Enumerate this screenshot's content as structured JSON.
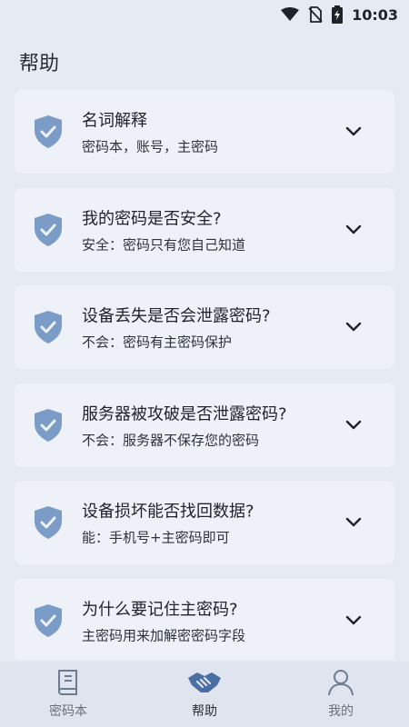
{
  "status_bar": {
    "time": "10:03"
  },
  "header": {
    "title": "帮助"
  },
  "faq": [
    {
      "question": "名词解释",
      "answer": "密码本，账号，主密码"
    },
    {
      "question": "我的密码是否安全?",
      "answer": "安全：密码只有您自己知道"
    },
    {
      "question": "设备丢失是否会泄露密码?",
      "answer": "不会：密码有主密码保护"
    },
    {
      "question": "服务器被攻破是否泄露密码?",
      "answer": "不会：服务器不保存您的密码"
    },
    {
      "question": "设备损坏能否找回数据?",
      "answer": "能：手机号+主密码即可"
    },
    {
      "question": "为什么要记住主密码?",
      "answer": "主密码用来加解密密码字段"
    }
  ],
  "bottom_nav": [
    {
      "label": "密码本",
      "icon": "book-icon",
      "active": false
    },
    {
      "label": "帮助",
      "icon": "handshake-icon",
      "active": true
    },
    {
      "label": "我的",
      "icon": "person-icon",
      "active": false
    }
  ],
  "colors": {
    "background": "#e6eaf2",
    "card": "#eef1f7",
    "shield": "#7a9cc6",
    "nav_active": "#4a6fa5"
  }
}
